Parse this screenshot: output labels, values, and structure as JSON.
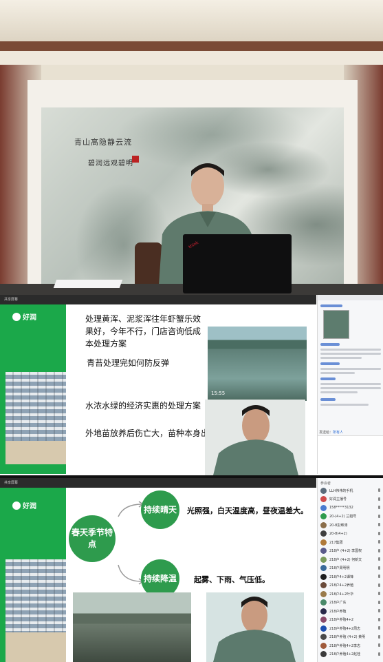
{
  "room": {
    "calligraphy_line1": "青山高隐静云流",
    "calligraphy_line2": "碧润远观碧明"
  },
  "slide1": {
    "toolbar_label": "共享屏幕",
    "logo": "好润",
    "text_lines": [
      "处理黄浑、泥浆浑往年虾蟹乐效果好，今年不行，门店咨询低成本处理方案",
      "青苔处理完如何防反弹",
      "水浓水绿的经济实惠的处理方案",
      "外地苗放养后伤亡大，苗种本身出问题，如"
    ],
    "photo_timestamp": "15:55",
    "chat_bottom_label": "发送给：",
    "chat_bottom_target": "所有人"
  },
  "slide2": {
    "toolbar_label": "共享屏幕",
    "logo": "好润",
    "center_circle": "春天季节特点",
    "circle_top": "持续晴天",
    "circle_bottom": "持续降温",
    "desc_top": "光照强，白天温度高，昼夜温差大。",
    "desc_bottom": "起雾、下雨、气压低。",
    "participants_header": "参会者",
    "participants": [
      {
        "name": "LLH伟伟的手机",
        "color": "#5b6b7a"
      },
      {
        "name": "好润主播号",
        "color": "#d04a4a"
      },
      {
        "name": "158*****3132",
        "color": "#4a7bd0"
      },
      {
        "name": "20-(4+2) 兰姐号",
        "color": "#2e9b4d"
      },
      {
        "name": "20-8彭辉涛",
        "color": "#8a6d4a"
      },
      {
        "name": "20-8(4+2)",
        "color": "#3f3f3f"
      },
      {
        "name": "217集团",
        "color": "#b07a3a"
      },
      {
        "name": "218户 (4+2) 李国权",
        "color": "#5a5a8a"
      },
      {
        "name": "218户 (4+2) 何新文",
        "color": "#7a9a5a"
      },
      {
        "name": "218户周明明",
        "color": "#3a6a9a"
      },
      {
        "name": "218户4+2谭锋",
        "color": "#1f1f1f"
      },
      {
        "name": "218户4+2养殖",
        "color": "#6a4a3a"
      },
      {
        "name": "218户4+2叶华",
        "color": "#9a7a4a"
      },
      {
        "name": "218户广东",
        "color": "#4a8a6a"
      },
      {
        "name": "218户养殖",
        "color": "#2a2a4a"
      },
      {
        "name": "218户养殖4+2",
        "color": "#8a4a6a"
      },
      {
        "name": "218户养殖4+2周志",
        "color": "#1c4fb0"
      },
      {
        "name": "218户养殖 (4+2) 黄明",
        "color": "#4a4a4a"
      },
      {
        "name": "218户养殖4+2李志",
        "color": "#a05a3a"
      },
      {
        "name": "218户养殖4+2赵桂",
        "color": "#3a3a3a"
      }
    ]
  },
  "colors": {
    "brand_green": "#1ba84a",
    "circle_green": "#2e9b4d",
    "toolbar_dark": "#2b2b2b"
  }
}
